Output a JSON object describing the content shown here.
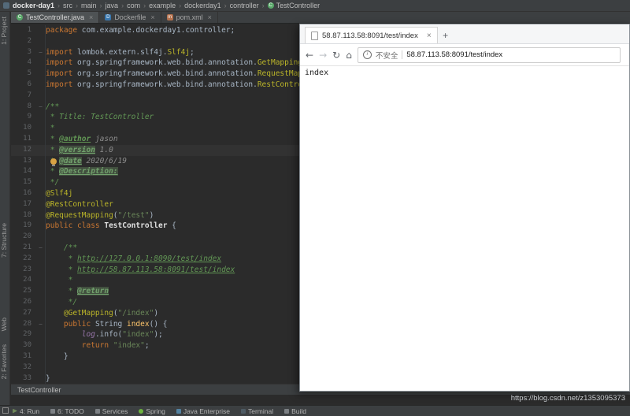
{
  "ide": {
    "breadcrumb_separator": "›",
    "breadcrumbs": [
      "docker-day1",
      "src",
      "main",
      "java",
      "com",
      "example",
      "dockerday1",
      "controller",
      "TestController"
    ],
    "tabs": [
      {
        "label": "TestController.java",
        "icon": "class",
        "glyph": "C",
        "active": true
      },
      {
        "label": "Dockerfile",
        "icon": "docker",
        "glyph": "D",
        "active": false
      },
      {
        "label": "pom.xml",
        "icon": "maven",
        "glyph": "m",
        "active": false
      }
    ],
    "stripe": [
      "1: Project",
      "7: Structure",
      "Web",
      "2: Favorites"
    ],
    "bottom_breadcrumb": "TestController",
    "status_bar": [
      {
        "label": "4: Run",
        "icon": "run"
      },
      {
        "label": "6: TODO",
        "icon": "todo"
      },
      {
        "label": "Services",
        "icon": "services"
      },
      {
        "label": "Spring",
        "icon": "spring"
      },
      {
        "label": "Java Enterprise",
        "icon": "javaee"
      },
      {
        "label": "Terminal",
        "icon": "terminal"
      },
      {
        "label": "Build",
        "icon": "build"
      }
    ]
  },
  "editor": {
    "lines": [
      {
        "s": [
          [
            "kw",
            "package"
          ],
          [
            "pl",
            " com.example.dockerday1.controller;"
          ]
        ]
      },
      {
        "s": []
      },
      {
        "s": [
          [
            "kw",
            "import"
          ],
          [
            "pl",
            " lombok.extern.slf4j."
          ],
          [
            "ann",
            "Slf4j"
          ],
          [
            "pl",
            ";"
          ]
        ],
        "fold": true
      },
      {
        "s": [
          [
            "kw",
            "import"
          ],
          [
            "pl",
            " org.springframework.web.bind.annotation."
          ],
          [
            "ann",
            "GetMapping"
          ],
          [
            "pl",
            ";"
          ]
        ]
      },
      {
        "s": [
          [
            "kw",
            "import"
          ],
          [
            "pl",
            " org.springframework.web.bind.annotation."
          ],
          [
            "ann",
            "RequestMapping"
          ],
          [
            "pl",
            ";"
          ]
        ]
      },
      {
        "s": [
          [
            "kw",
            "import"
          ],
          [
            "pl",
            " org.springframework.web.bind.annotation."
          ],
          [
            "ann",
            "RestController"
          ],
          [
            "pl",
            ";"
          ]
        ]
      },
      {
        "s": []
      },
      {
        "s": [
          [
            "doc",
            "/**"
          ]
        ],
        "fold": true
      },
      {
        "s": [
          [
            "doc",
            " * Title: TestController"
          ]
        ]
      },
      {
        "s": [
          [
            "doc",
            " *"
          ]
        ]
      },
      {
        "s": [
          [
            "doc",
            " * "
          ],
          [
            "tag",
            "@author"
          ],
          [
            "val",
            " jason"
          ]
        ]
      },
      {
        "s": [
          [
            "doc",
            " * "
          ],
          [
            "tagh",
            "@version"
          ],
          [
            "val",
            " 1.0"
          ]
        ],
        "caret": true
      },
      {
        "s": [
          [
            "doc",
            " * "
          ],
          [
            "tagh",
            "@date"
          ],
          [
            "val",
            " 2020/6/19"
          ]
        ]
      },
      {
        "s": [
          [
            "doc",
            " * "
          ],
          [
            "tagh",
            "@Description:"
          ]
        ]
      },
      {
        "s": [
          [
            "doc",
            " */"
          ]
        ]
      },
      {
        "s": [
          [
            "ann",
            "@Slf4j"
          ]
        ]
      },
      {
        "s": [
          [
            "ann",
            "@RestController"
          ]
        ]
      },
      {
        "s": [
          [
            "ann",
            "@RequestMapping"
          ],
          [
            "pl",
            "("
          ],
          [
            "str",
            "\"/test\""
          ],
          [
            "pl",
            ")"
          ]
        ]
      },
      {
        "s": [
          [
            "kw",
            "public class "
          ],
          [
            "cls",
            "TestController"
          ],
          [
            "pl",
            " {"
          ]
        ]
      },
      {
        "s": []
      },
      {
        "s": [
          [
            "doc",
            "    /**"
          ]
        ],
        "fold": true
      },
      {
        "s": [
          [
            "doc",
            "     * "
          ],
          [
            "lnk",
            "http://127.0.0.1:8090/test/index"
          ]
        ]
      },
      {
        "s": [
          [
            "doc",
            "     * "
          ],
          [
            "lnk",
            "http://58.87.113.58:8091/test/index"
          ]
        ]
      },
      {
        "s": [
          [
            "doc",
            "     *"
          ]
        ]
      },
      {
        "s": [
          [
            "doc",
            "     * "
          ],
          [
            "tagh",
            "@return"
          ]
        ]
      },
      {
        "s": [
          [
            "doc",
            "     */"
          ]
        ]
      },
      {
        "s": [
          [
            "pl",
            "    "
          ],
          [
            "ann",
            "@GetMapping"
          ],
          [
            "pl",
            "("
          ],
          [
            "str",
            "\"/index\""
          ],
          [
            "pl",
            ")"
          ]
        ]
      },
      {
        "s": [
          [
            "pl",
            "    "
          ],
          [
            "kw",
            "public"
          ],
          [
            "pl",
            " String "
          ],
          [
            "mth",
            "index"
          ],
          [
            "pl",
            "() {"
          ]
        ],
        "fold": true
      },
      {
        "s": [
          [
            "pl",
            "        "
          ],
          [
            "fld",
            "log"
          ],
          [
            "pl",
            ".info("
          ],
          [
            "str",
            "\"index\""
          ],
          [
            "pl",
            ");"
          ]
        ]
      },
      {
        "s": [
          [
            "pl",
            "        "
          ],
          [
            "kw",
            "return"
          ],
          [
            "pl",
            " "
          ],
          [
            "str",
            "\"index\""
          ],
          [
            "pl",
            ";"
          ]
        ]
      },
      {
        "s": [
          [
            "pl",
            "    }"
          ]
        ]
      },
      {
        "s": []
      },
      {
        "s": [
          [
            "pl",
            "}"
          ]
        ]
      }
    ]
  },
  "browser": {
    "tab_title": "58.87.113.58:8091/test/index",
    "new_tab_label": "+",
    "nav": {
      "back": "←",
      "forward": "→",
      "refresh": "↻",
      "home": "⌂"
    },
    "security_label": "不安全",
    "url": "58.87.113.58:8091/test/index",
    "page_text": "index"
  },
  "watermark": "https://blog.csdn.net/z1353095373",
  "colors": {
    "ide_bg": "#2b2b2b",
    "ide_bar": "#3c3f41",
    "keyword": "#cc7832",
    "string": "#6a8759",
    "annotation": "#bbb529",
    "javadoc": "#629755"
  }
}
